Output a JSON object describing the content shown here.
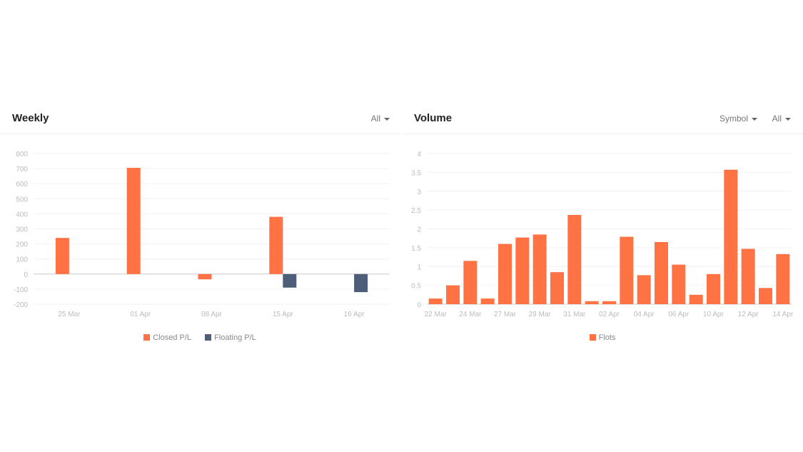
{
  "weekly": {
    "title": "Weekly",
    "filter": "All",
    "legend": [
      "Closed P/L",
      "Floating P/L"
    ]
  },
  "volume": {
    "title": "Volume",
    "filter_symbol": "Symbol",
    "filter_all": "All",
    "legend": [
      "Flots"
    ]
  },
  "chart_data": [
    {
      "type": "bar",
      "categories": [
        "25 Mar",
        "01 Apr",
        "08 Apr",
        "15 Apr",
        "16 Apr"
      ],
      "series": [
        {
          "name": "Closed P/L",
          "color": "#ff7243",
          "values": [
            240,
            705,
            -35,
            380,
            null
          ]
        },
        {
          "name": "Floating P/L",
          "color": "#4e5d78",
          "values": [
            null,
            null,
            null,
            -90,
            -120
          ]
        }
      ],
      "yticks": [
        800,
        700,
        600,
        500,
        400,
        300,
        200,
        100,
        0,
        -100,
        -200
      ],
      "ylim": [
        -200,
        800
      ],
      "grid": true,
      "legend_position": "bottom"
    },
    {
      "type": "bar",
      "categories": [
        "22 Mar",
        "",
        "24 Mar",
        "",
        "27 Mar",
        "",
        "29 Mar",
        "",
        "31 Mar",
        "",
        "02 Apr",
        "",
        "04 Apr",
        "",
        "06 Apr",
        "",
        "10 Apr",
        "",
        "12 Apr",
        "",
        "14 Apr"
      ],
      "series": [
        {
          "name": "Flots",
          "color": "#ff7243",
          "values": [
            0.15,
            0.5,
            1.15,
            0.15,
            1.6,
            1.77,
            1.85,
            0.85,
            2.37,
            0.08,
            0.08,
            1.79,
            0.77,
            1.65,
            1.05,
            0.25,
            0.8,
            3.57,
            1.47,
            0.43,
            1.33
          ]
        }
      ],
      "yticks": [
        "4",
        "3.5",
        "3",
        "2.5",
        "2",
        "1.5",
        "1",
        "0.5",
        "0"
      ],
      "ylim": [
        0,
        4
      ],
      "grid": true,
      "legend_position": "bottom"
    }
  ]
}
